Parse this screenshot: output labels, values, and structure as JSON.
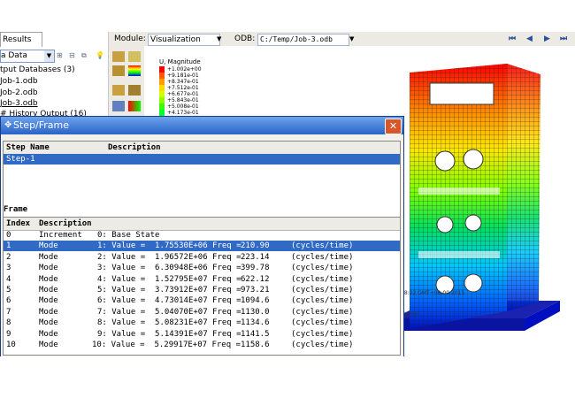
{
  "left_panel": {
    "tab": "Results",
    "data_select": "a Data",
    "tree": [
      "tput Databases (3)",
      "Job-1.odb",
      "Job-2.odb",
      "Job-3.odb",
      "# History Output (16)"
    ]
  },
  "module_bar": {
    "module_label": "Module:",
    "module_value": "Visualization",
    "odb_label": "ODB:",
    "odb_value": "C:/Temp/Job-3.odb"
  },
  "legend": {
    "title": "U, Magnitude",
    "values": [
      "+1.002e+00",
      "+9.181e-01",
      "+8.347e-01",
      "+7.512e-01",
      "+6.677e-01",
      "+5.843e-01",
      "+5.008e-01",
      "+4.173e-01",
      "+3.339e-01"
    ],
    "colors": [
      "#ff0000",
      "#ff5a00",
      "#ff9c00",
      "#ffd800",
      "#d7ff00",
      "#8eff00",
      "#3aff00",
      "#00ff30",
      "#00ff8a"
    ]
  },
  "viewport": {
    "stamp": "18:02 GMT+08:00 2015",
    "units": "s/time)"
  },
  "dialog": {
    "title": "Step/Frame",
    "step_headers": {
      "name": "Step Name",
      "desc": "Description"
    },
    "steps": [
      {
        "name": "Step-1",
        "desc": ""
      }
    ],
    "frame_label": "Frame",
    "frame_headers": {
      "index": "Index",
      "desc": "Description"
    },
    "frames": [
      {
        "index": "0",
        "kind": "Increment",
        "detail": "0: Base State",
        "freq": "",
        "unit": ""
      },
      {
        "index": "1",
        "kind": "Mode",
        "detail": "1: Value =  1.75530E+06 Freq =",
        "freq": "210.90",
        "unit": "(cycles/time)"
      },
      {
        "index": "2",
        "kind": "Mode",
        "detail": "2: Value =  1.96572E+06 Freq =",
        "freq": "223.14",
        "unit": "(cycles/time)"
      },
      {
        "index": "3",
        "kind": "Mode",
        "detail": "3: Value =  6.30948E+06 Freq =",
        "freq": "399.78",
        "unit": "(cycles/time)"
      },
      {
        "index": "4",
        "kind": "Mode",
        "detail": "4: Value =  1.52795E+07 Freq =",
        "freq": "622.12",
        "unit": "(cycles/time)"
      },
      {
        "index": "5",
        "kind": "Mode",
        "detail": "5: Value =  3.73912E+07 Freq =",
        "freq": "973.21",
        "unit": "(cycles/time)"
      },
      {
        "index": "6",
        "kind": "Mode",
        "detail": "6: Value =  4.73014E+07 Freq =",
        "freq": "1094.6",
        "unit": "(cycles/time)"
      },
      {
        "index": "7",
        "kind": "Mode",
        "detail": "7: Value =  5.04070E+07 Freq =",
        "freq": "1130.0",
        "unit": "(cycles/time)"
      },
      {
        "index": "8",
        "kind": "Mode",
        "detail": "8: Value =  5.08231E+07 Freq =",
        "freq": "1134.6",
        "unit": "(cycles/time)"
      },
      {
        "index": "9",
        "kind": "Mode",
        "detail": "9: Value =  5.14391E+07 Freq =",
        "freq": "1141.5",
        "unit": "(cycles/time)"
      },
      {
        "index": "10",
        "kind": "Mode",
        "detail": "10: Value =  5.29917E+07 Freq =",
        "freq": "1158.6",
        "unit": "(cycles/time)"
      }
    ]
  }
}
